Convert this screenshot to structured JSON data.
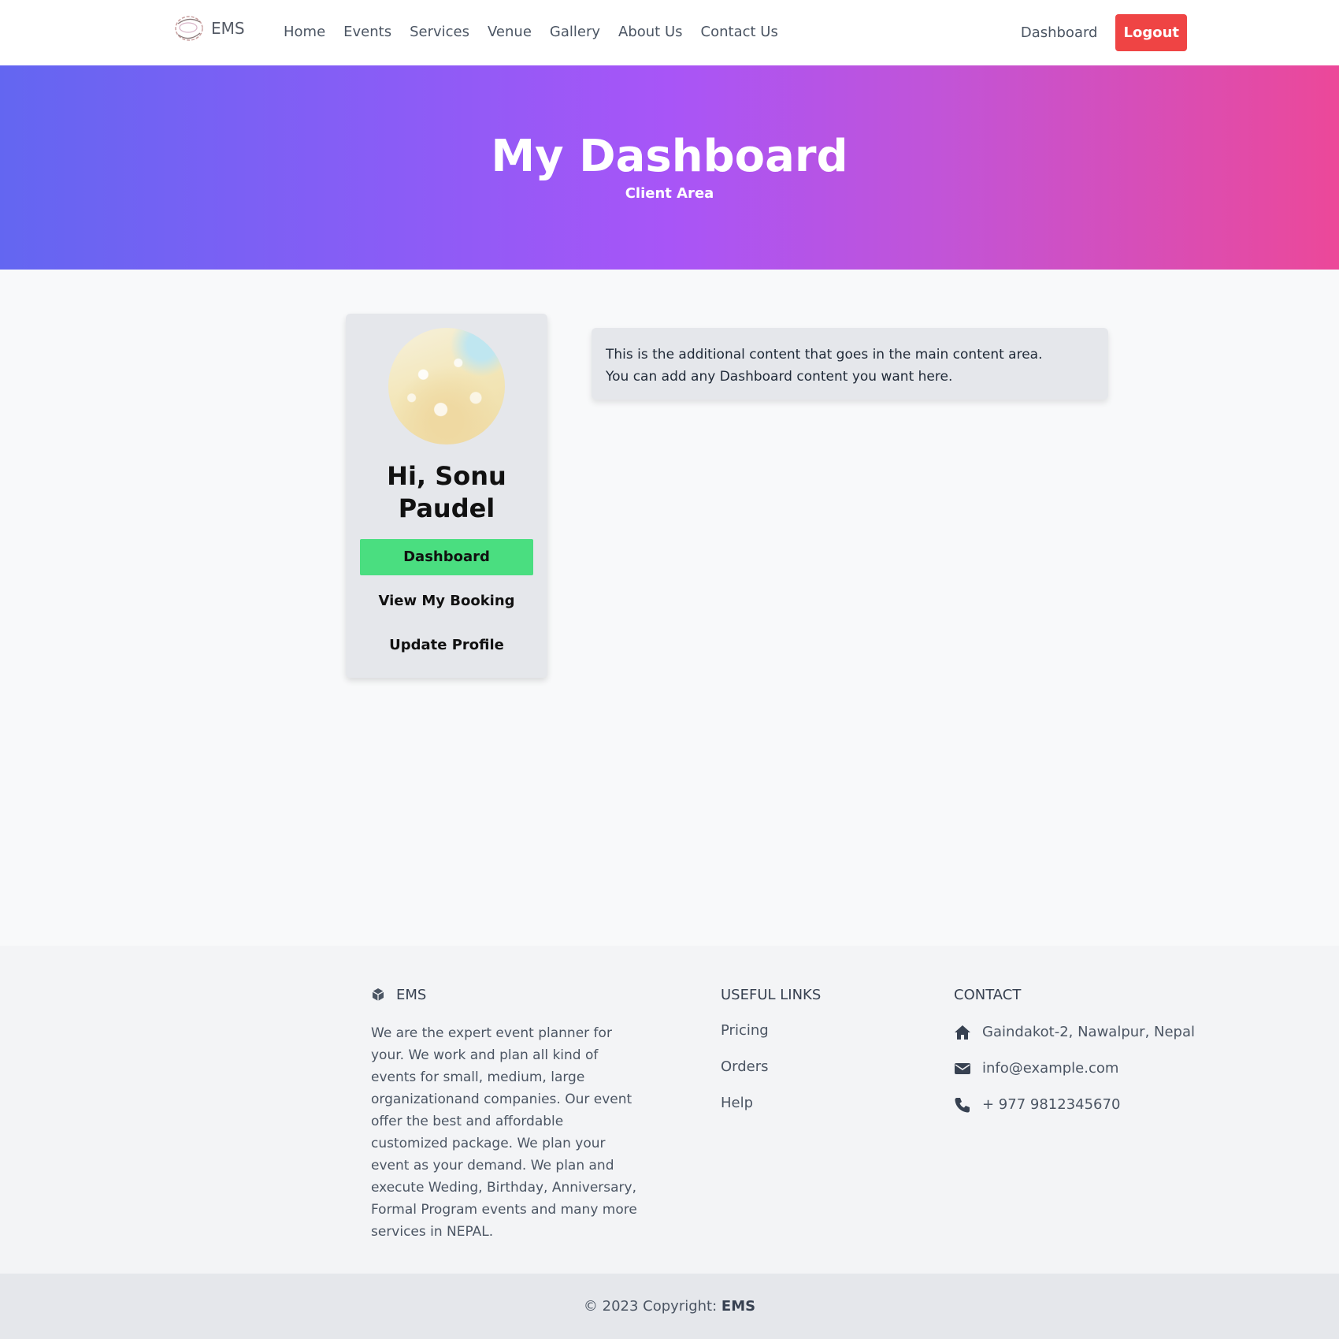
{
  "navbar": {
    "brand": "EMS",
    "links": [
      "Home",
      "Events",
      "Services",
      "Venue",
      "Gallery",
      "About Us",
      "Contact Us"
    ],
    "dashboard_label": "Dashboard",
    "logout_label": "Logout"
  },
  "hero": {
    "title": "My Dashboard",
    "subtitle": "Client Area"
  },
  "sidebar": {
    "greeting": "Hi, Sonu Paudel",
    "buttons": [
      "Dashboard",
      "View My Booking",
      "Update Profile"
    ]
  },
  "main": {
    "line1": "This is the additional content that goes in the main content area.",
    "line2": "You can add any Dashboard content you want here."
  },
  "footer": {
    "brand": "EMS",
    "about": "We are the expert event planner for your. We work and plan all kind of events for small, medium, large organizationand companies. Our event offer the best and affordable customized package. We plan your event as your demand. We plan and execute Weding, Birthday, Anniversary, Formal Program events and many more services in NEPAL.",
    "links_heading": "USEFUL LINKS",
    "links": [
      "Pricing",
      "Orders",
      "Help"
    ],
    "contact_heading": "CONTACT",
    "address": "Gaindakot-2, Nawalpur, Nepal",
    "email": "info@example.com",
    "phone": "+ 977 9812345670"
  },
  "copyright": {
    "text": "© 2023 Copyright: ",
    "brand": "EMS"
  },
  "colors": {
    "logout": "#ef4444",
    "active_button": "#4ade80",
    "hero_start": "#6366f1",
    "hero_end": "#ec4899"
  }
}
